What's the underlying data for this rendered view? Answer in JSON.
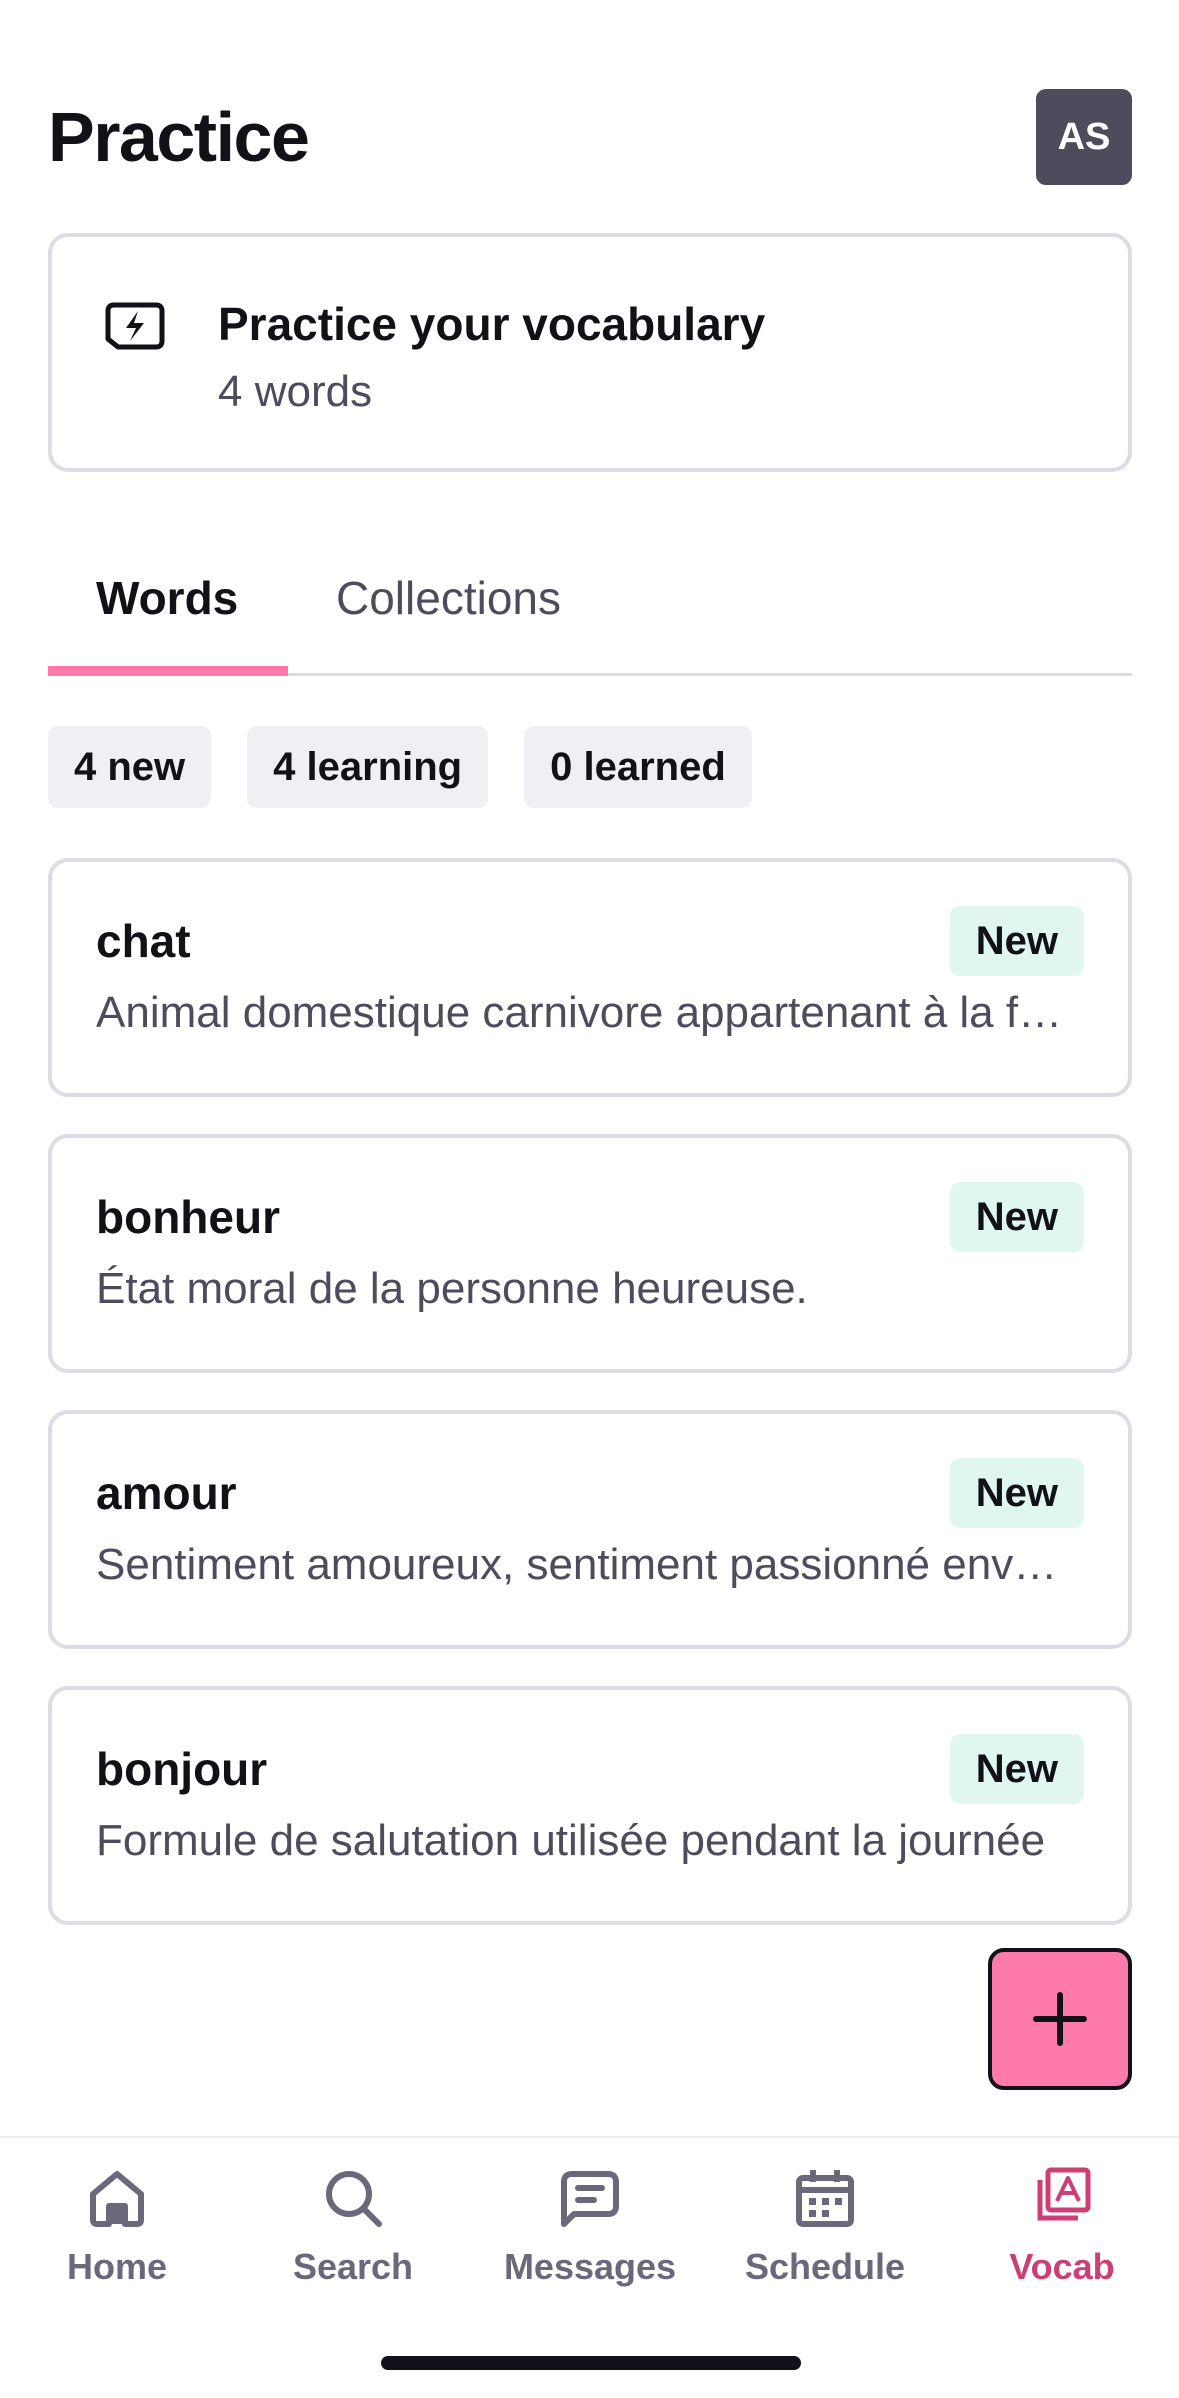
{
  "header": {
    "title": "Practice",
    "avatar_initials": "AS"
  },
  "practice_card": {
    "icon": "bolt-icon",
    "title": "Practice your vocabulary",
    "subtitle": "4 words"
  },
  "tabs": [
    {
      "label": "Words",
      "active": true
    },
    {
      "label": "Collections",
      "active": false
    }
  ],
  "chips": [
    "4 new",
    "4 learning",
    "0 learned"
  ],
  "words": [
    {
      "word": "chat",
      "definition": "Animal domestique carnivore appartenant à la famille des félidés",
      "badge": "New"
    },
    {
      "word": "bonheur",
      "definition": "État moral de la personne heureuse.",
      "badge": "New"
    },
    {
      "word": "amour",
      "definition": "Sentiment amoureux, sentiment passionné envers quelqu'un",
      "badge": "New"
    },
    {
      "word": "bonjour",
      "definition": "Formule de salutation utilisée pendant la journée",
      "badge": "New"
    }
  ],
  "fab": {
    "icon": "plus-icon"
  },
  "bottom_nav": [
    {
      "label": "Home",
      "icon": "home-icon",
      "active": false
    },
    {
      "label": "Search",
      "icon": "search-icon",
      "active": false
    },
    {
      "label": "Messages",
      "icon": "messages-icon",
      "active": false
    },
    {
      "label": "Schedule",
      "icon": "calendar-icon",
      "active": false
    },
    {
      "label": "Vocab",
      "icon": "vocab-icon",
      "active": true
    }
  ],
  "colors": {
    "accent_pink": "#ff7aac",
    "active_nav": "#cc3e75",
    "badge_bg": "#dff7ef",
    "avatar_bg": "#4d4c5c"
  }
}
